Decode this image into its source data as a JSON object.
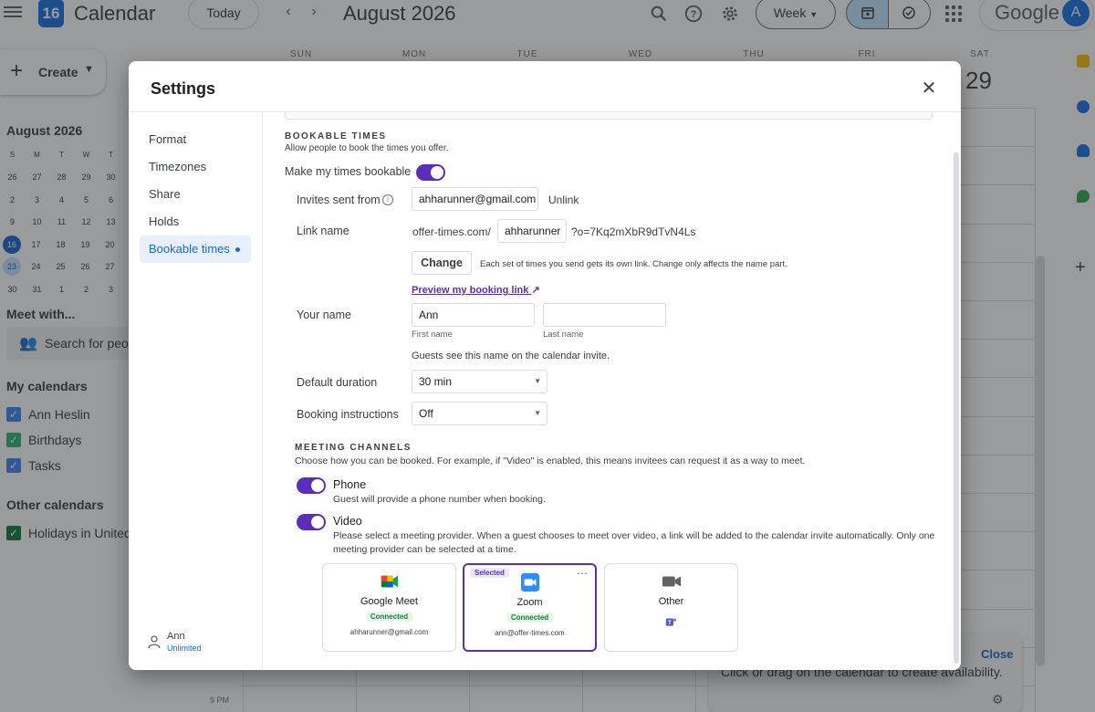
{
  "topbar": {
    "app_title": "Calendar",
    "logo_day": "16",
    "today_label": "Today",
    "prev_label": "‹",
    "next_label": "›",
    "month_title": "August 2026",
    "view_label": "Week",
    "google_label": "Google",
    "avatar_initial": "A"
  },
  "sidebar": {
    "create_label": "Create",
    "mini_cal": {
      "title": "August 2026",
      "weekdays": [
        "S",
        "M",
        "T",
        "W",
        "T"
      ],
      "weeks": [
        [
          "26",
          "27",
          "28",
          "29",
          "30"
        ],
        [
          "2",
          "3",
          "4",
          "5",
          "6"
        ],
        [
          "9",
          "10",
          "11",
          "12",
          "13"
        ],
        [
          "16",
          "17",
          "18",
          "19",
          "20"
        ],
        [
          "23",
          "24",
          "25",
          "26",
          "27"
        ],
        [
          "30",
          "31",
          "1",
          "2",
          "3"
        ]
      ],
      "today": "16",
      "selected": "23"
    },
    "meet_with": "Meet with...",
    "people_placeholder": "Search for people",
    "my_calendars_title": "My calendars",
    "my_calendars": [
      {
        "name": "Ann Heslin",
        "color": "#4285f4"
      },
      {
        "name": "Birthdays",
        "color": "#33b679"
      },
      {
        "name": "Tasks",
        "color": "#4285f4"
      }
    ],
    "other_calendars_title": "Other calendars",
    "other_calendars": [
      {
        "name": "Holidays in United States",
        "color": "#0b8043"
      }
    ]
  },
  "week": {
    "days": [
      "SUN",
      "MON",
      "TUE",
      "WED",
      "THU",
      "FRI",
      "SAT"
    ],
    "sat_date": "29",
    "time_label": "9 PM",
    "availability_panel": {
      "close_label": "Close",
      "text": "Click or drag on the calendar to create availability."
    }
  },
  "settings": {
    "title": "Settings",
    "nav": [
      {
        "label": "Format"
      },
      {
        "label": "Timezones"
      },
      {
        "label": "Share"
      },
      {
        "label": "Holds"
      },
      {
        "label": "Bookable times"
      }
    ],
    "user": {
      "name": "Ann",
      "plan": "Unlimited"
    },
    "bookable": {
      "section_title": "BOOKABLE TIMES",
      "section_sub": "Allow people to book the times you offer.",
      "make_bookable_label": "Make my times bookable",
      "make_bookable_on": true,
      "invites_sent_from_label": "Invites sent from",
      "invites_sent_from_value": "ahharunner@gmail.com",
      "unlink_label": "Unlink",
      "link_name_label": "Link name",
      "link_prefix": "offer-times.com/",
      "link_name_value": "ahharunner",
      "link_suffix": "?o=7Kq2mXbR9dTvN4Ls",
      "change_label": "Change",
      "change_help": "Each set of times you send gets its own link. Change only affects the name part.",
      "preview_link": "Preview my booking link",
      "your_name_label": "Your name",
      "first_name_value": "Ann",
      "last_name_value": "",
      "first_name_help": "First name",
      "last_name_help": "Last name",
      "guests_note": "Guests see this name on the calendar invite.",
      "default_duration_label": "Default duration",
      "default_duration_value": "30 min",
      "booking_instructions_label": "Booking instructions",
      "booking_instructions_value": "Off"
    },
    "channels": {
      "section_title": "MEETING CHANNELS",
      "section_sub": "Choose how you can be booked. For example, if \"Video\" is enabled, this means invitees can request it as a way to meet.",
      "phone_label": "Phone",
      "phone_desc": "Guest will provide a phone number when booking.",
      "phone_on": true,
      "video_label": "Video",
      "video_desc": "Please select a meeting provider. When a guest chooses to meet over video, a link will be added to the calendar invite automatically. Only one meeting provider can be selected at a time.",
      "video_on": true,
      "providers": [
        {
          "name": "Google Meet",
          "status": "Connected",
          "account": "ahharunner@gmail.com",
          "selected": false
        },
        {
          "name": "Zoom",
          "status": "Connected",
          "account": "ann@offer-times.com",
          "selected": true,
          "badge": "Selected"
        },
        {
          "name": "Other",
          "status": "",
          "account": "",
          "selected": false
        }
      ]
    },
    "colors": {
      "accent": "#5b2dbd",
      "connected": "#188038"
    }
  }
}
